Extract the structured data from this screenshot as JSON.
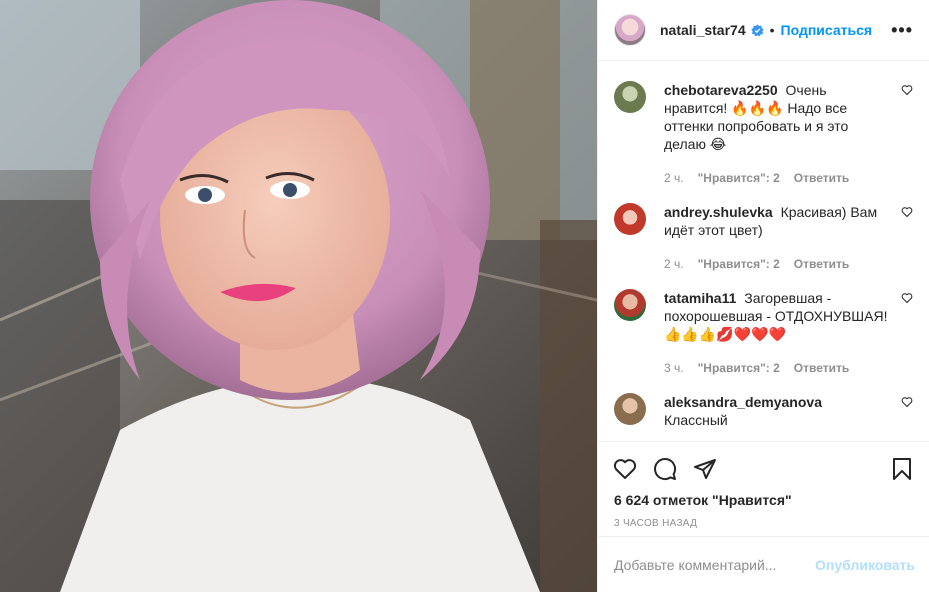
{
  "post": {
    "photo_alt": "",
    "header": {
      "username": "natali_star74",
      "separator": "•",
      "follow_label": "Подписаться",
      "more_label": "•••"
    },
    "comments": [
      {
        "username": "chebotareva2250",
        "text": "Очень нравится! 🔥🔥🔥 Надо все оттенки попробовать и я это делаю 😂",
        "time": "2 ч.",
        "likes": "\"Нравится\": 2",
        "reply": "Ответить",
        "avatar_color": "#6b7a4f"
      },
      {
        "username": "andrey.shulevka",
        "text": "Красивая) Вам идёт этот цвет)",
        "time": "2 ч.",
        "likes": "\"Нравится\": 2",
        "reply": "Ответить",
        "avatar_color": "#c0392b"
      },
      {
        "username": "tatamiha11",
        "text": "Загоревшая - похорошевшая - ОТДОХНУВШАЯ! 👍👍👍💋❤️❤️❤️",
        "time": "3 ч.",
        "likes": "\"Нравится\": 2",
        "reply": "Ответить",
        "avatar_color": "#b03a2e"
      },
      {
        "username": "aleksandra_demyanova",
        "text": "Классный",
        "time": "",
        "likes": "",
        "reply": "",
        "avatar_color": "#8a6d4f"
      }
    ],
    "likes_text": "6 624 отметок \"Нравится\"",
    "posted_ago": "3 ЧАСОВ НАЗАД",
    "add_comment": {
      "placeholder": "Добавьте комментарий...",
      "publish_label": "Опубликовать"
    },
    "colors": {
      "accent": "#0095f6",
      "publish_disabled": "#b2dffc",
      "meta_gray": "#8e8e8e",
      "text": "#262626"
    },
    "icons": {
      "like": "heart-icon",
      "comment": "comment-icon",
      "share": "paper-plane-icon",
      "save": "bookmark-icon",
      "verified": "verified-badge-icon",
      "more": "more-options-icon"
    }
  }
}
